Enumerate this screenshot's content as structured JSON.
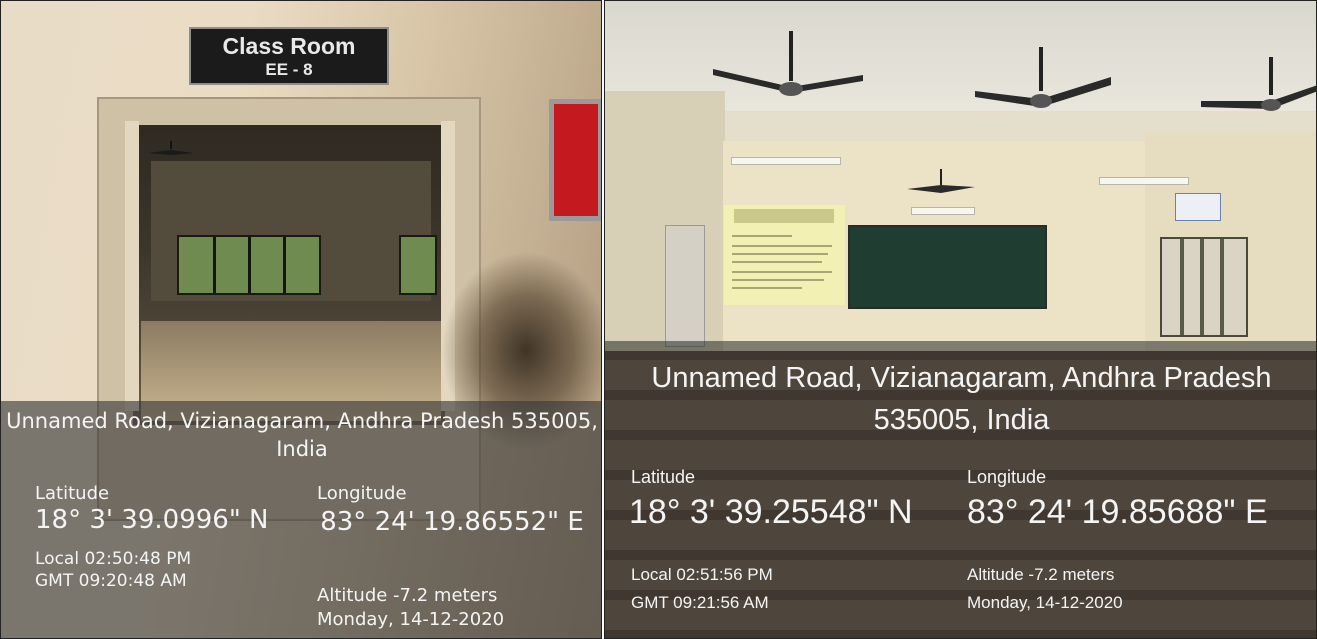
{
  "left_photo": {
    "sign": {
      "line1": "Class Room",
      "line2": "EE - 8"
    },
    "address": "Unnamed Road, Vizianagaram, Andhra Pradesh 535005, India",
    "latitude_label": "Latitude",
    "latitude_value": "18° 3' 39.0996\" N",
    "longitude_label": "Longitude",
    "longitude_value": "83° 24' 19.86552\" E",
    "local_time": "Local 02:50:48 PM",
    "gmt_time": "GMT 09:20:48 AM",
    "altitude": "Altitude -7.2 meters",
    "date": "Monday, 14-12-2020"
  },
  "right_photo": {
    "address": "Unnamed Road, Vizianagaram, Andhra Pradesh 535005, India",
    "latitude_label": "Latitude",
    "latitude_value": "18° 3' 39.25548\" N",
    "longitude_label": "Longitude",
    "longitude_value": "83° 24' 19.85688\" E",
    "local_time": "Local 02:51:56 PM",
    "gmt_time": "GMT 09:21:56 AM",
    "altitude": "Altitude -7.2 meters",
    "date": "Monday, 14-12-2020"
  },
  "colors": {
    "overlay": "#373737",
    "text": "#f4f4f4",
    "sign_bg": "#1b1b1b",
    "red_board": "#c4191f",
    "chalkboard": "#1f3d31"
  }
}
